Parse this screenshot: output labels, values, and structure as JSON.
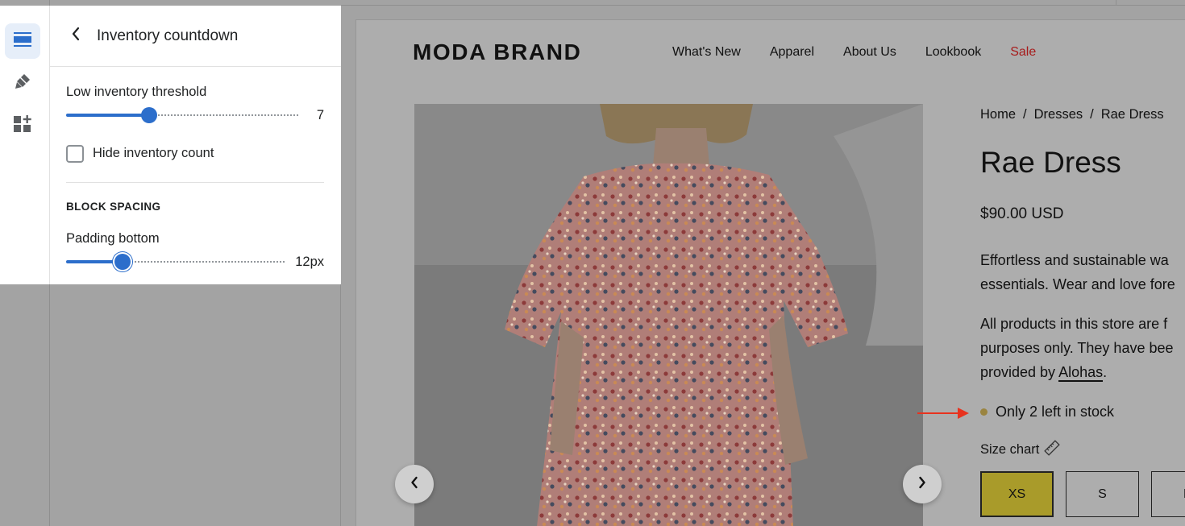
{
  "rail": {
    "items": [
      {
        "name": "sections",
        "active": true
      },
      {
        "name": "theme-settings",
        "active": false
      },
      {
        "name": "app-embeds",
        "active": false
      }
    ]
  },
  "panel": {
    "title": "Inventory countdown",
    "threshold_label": "Low inventory threshold",
    "threshold_value": "7",
    "hide_count_label": "Hide inventory count",
    "hide_count_checked": false,
    "section_heading": "BLOCK SPACING",
    "padding_label": "Padding bottom",
    "padding_value": "12px"
  },
  "store": {
    "brand": "MODA BRAND",
    "nav": [
      "What's New",
      "Apparel",
      "About Us",
      "Lookbook",
      "Sale"
    ],
    "breadcrumb": [
      "Home",
      "Dresses",
      "Rae Dress"
    ],
    "product_title": "Rae Dress",
    "price": "$90.00 USD",
    "desc1_line1": "Effortless and sustainable wa",
    "desc1_line2": "essentials. Wear and love fore",
    "desc2_line1": "All products in this store are f",
    "desc2_line2": "purposes only. They have bee",
    "desc2_line3_prefix": "provided by ",
    "desc2_link": "Alohas",
    "desc2_line3_suffix": ".",
    "stock_text": "Only 2 left in stock",
    "size_chart_label": "Size chart",
    "sizes": [
      "XS",
      "S",
      "M"
    ],
    "selected_size": "XS"
  },
  "colors": {
    "accent": "#2c6ecb",
    "sale": "#a71b1b",
    "selected_size": "#a99b2a",
    "stock_dot": "#9a8440",
    "annotation_arrow": "#e8321e"
  }
}
